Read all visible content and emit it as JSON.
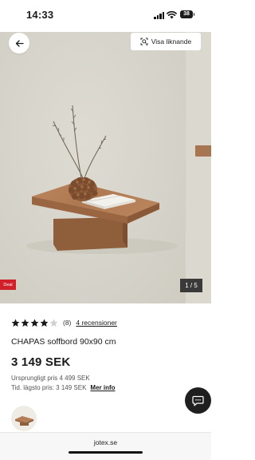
{
  "status_bar": {
    "time": "14:33",
    "battery": "38"
  },
  "gallery": {
    "back_icon": "arrow-left-icon",
    "similar_label": "Visa liknande",
    "similar_icon": "visual-search-icon",
    "deal_label": "Deal",
    "counter": "1 / 5"
  },
  "product": {
    "rating": 4,
    "rating_max": 5,
    "review_count": "(8)",
    "reviews_link": "4 recensioner",
    "name": "CHAPAS soffbord 90x90 cm",
    "price": "3 149 SEK",
    "original_price": "Ursprungligt pris 4 499 SEK",
    "lowest_price": "Tid. lägsto pris: 3 149 SEK",
    "more_info": "Mer info"
  },
  "chat": {
    "icon": "chat-bubble-icon"
  },
  "browser": {
    "url": "jotex.se"
  },
  "colors": {
    "deal": "#d0202a",
    "text": "#1a1a1a",
    "chat_bg": "#1f1f1f"
  }
}
